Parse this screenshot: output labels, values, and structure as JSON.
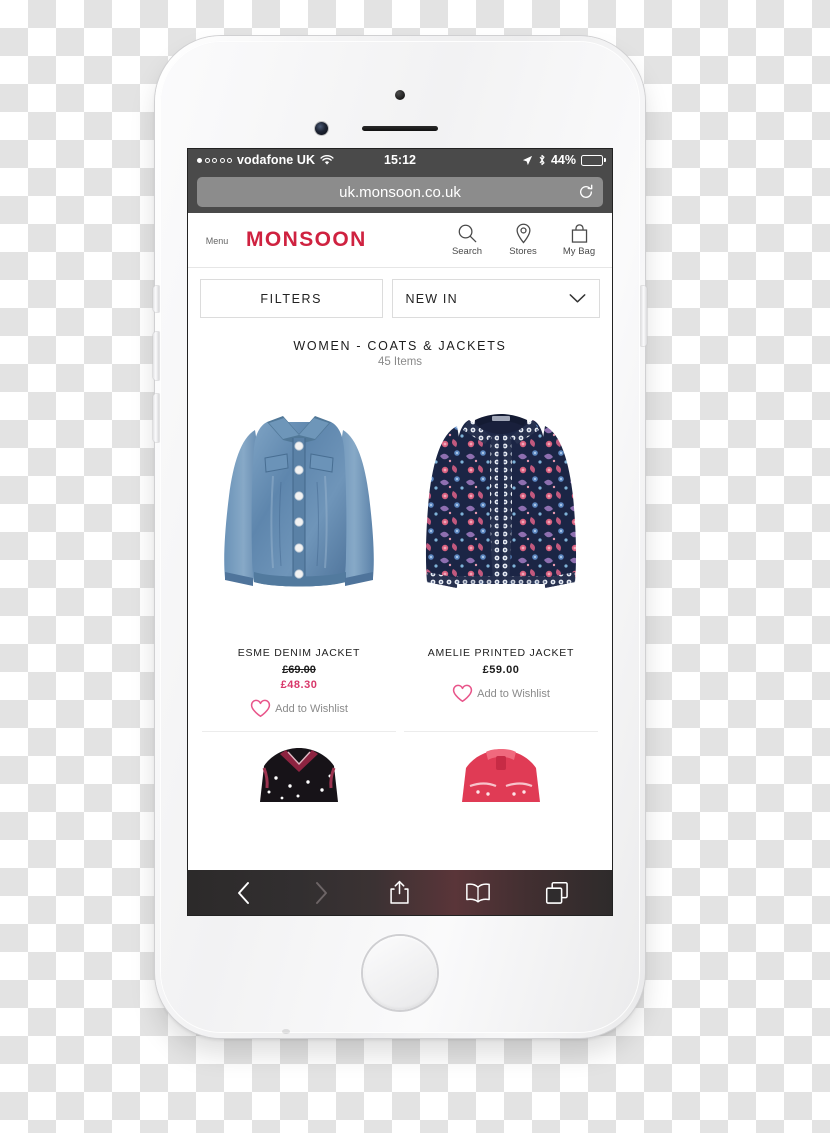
{
  "device": {
    "name": "white-iphone",
    "hardware": {
      "front_camera": "front-camera",
      "earpiece": "earpiece-speaker",
      "sensor": "proximity-sensor",
      "home_button": "home-button"
    }
  },
  "status_bar": {
    "signal_dots_total": 5,
    "signal_dots_filled": 1,
    "carrier": "vodafone UK",
    "wifi_icon": "wifi-icon",
    "time": "15:12",
    "location_icon": "location-arrow-icon",
    "bluetooth_icon": "bluetooth-icon",
    "battery_percent": "44%",
    "battery_level": 44,
    "battery_color": "#f5bf12"
  },
  "browser": {
    "url": "uk.monsoon.co.uk",
    "reload_icon": "reload-icon",
    "toolbar": {
      "back_label": "back-chevron-icon",
      "forward_label": "forward-chevron-icon",
      "share_label": "share-icon",
      "bookmarks_label": "bookmarks-book-icon",
      "tabs_label": "tabs-icon"
    }
  },
  "site_header": {
    "menu_label": "Menu",
    "brand": "MONSOON",
    "brand_color": "#cf2240",
    "actions": [
      {
        "icon": "search-icon",
        "label": "Search"
      },
      {
        "icon": "store-pin-icon",
        "label": "Stores"
      },
      {
        "icon": "shopping-bag-icon",
        "label": "My Bag"
      }
    ]
  },
  "controls": {
    "filters_label": "FILTERS",
    "sort_value": "NEW IN",
    "sort_chevron": "chevron-down-icon"
  },
  "category": {
    "title": "WOMEN - COATS & JACKETS",
    "count": "45 Items"
  },
  "wishlist": {
    "label": "Add to Wishlist",
    "heart_icon": "heart-outline-icon",
    "heart_color": "#e8558a"
  },
  "products": [
    {
      "name": "ESME DENIM JACKET",
      "image": "denim-jacket-blue",
      "price_was": "£69.00",
      "price_now": "£48.30",
      "on_sale": true
    },
    {
      "name": "AMELIE PRINTED JACKET",
      "image": "navy-floral-printed-jacket",
      "price": "£59.00",
      "on_sale": false
    }
  ],
  "products_next_row": [
    {
      "image": "black-embellished-top"
    },
    {
      "image": "red-jacket"
    }
  ]
}
